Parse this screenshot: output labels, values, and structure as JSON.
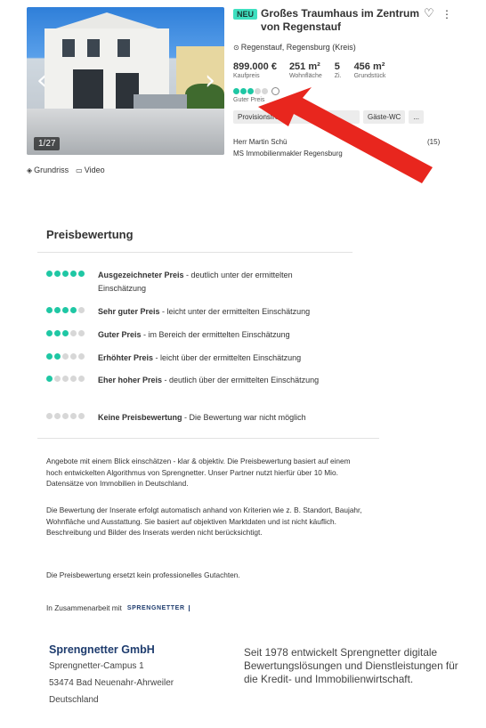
{
  "listing": {
    "photo_counter": "1/27",
    "badge": "NEU",
    "title": "Großes Traumhaus im Zentrum von Regenstauf",
    "location": "Regenstauf, Regensburg (Kreis)",
    "facts": [
      {
        "value": "899.000 €",
        "label": "Kaufpreis"
      },
      {
        "value": "251 m²",
        "label": "Wohnfläche"
      },
      {
        "value": "5",
        "label": "Zi."
      },
      {
        "value": "456 m²",
        "label": "Grundstück"
      }
    ],
    "rating": {
      "filled": 3,
      "total": 5,
      "label": "Guter Preis"
    },
    "tags": [
      "Provisionsfrei",
      "Gäste-WC",
      "..."
    ],
    "agent_name": "Herr Martin Schü",
    "agent_company": "MS Immobilienmakler Regensburg",
    "agent_count": "(15)",
    "media": {
      "floorplan": "Grundriss",
      "video": "Video"
    },
    "icons": {
      "favorite": "heart-icon",
      "more": "more-vertical-icon",
      "location": "pin-icon"
    }
  },
  "price_rating": {
    "title": "Preisbewertung",
    "levels": [
      {
        "filled": 5,
        "name": "Ausgezeichneter Preis",
        "desc": " - deutlich unter der ermittelten Einschätzung"
      },
      {
        "filled": 4,
        "name": "Sehr guter Preis",
        "desc": " - leicht unter der ermittelten Einschätzung"
      },
      {
        "filled": 3,
        "name": "Guter Preis",
        "desc": " - im Bereich der ermittelten Einschätzung"
      },
      {
        "filled": 2,
        "name": "Erhöhter Preis",
        "desc": " - leicht über der ermittelten Einschätzung"
      },
      {
        "filled": 1,
        "name": "Eher hoher Preis",
        "desc": " - deutlich über der ermittelten Einschätzung"
      },
      {
        "filled": 0,
        "name": "Keine Preisbewertung",
        "desc": " - Die Bewertung war nicht möglich"
      }
    ],
    "para1": "Angebote mit einem Blick einschätzen - klar & objektiv. Die Preisbewertung basiert auf einem hoch entwickelten Algorithmus von Sprengnetter. Unser Partner nutzt hierfür über 10 Mio. Datensätze von Immobilien in Deutschland.",
    "para2": "Die Bewertung der Inserate erfolgt automatisch anhand von Kriterien wie z. B. Standort, Baujahr, Wohnfläche und Ausstattung. Sie basiert auf objektiven Marktdaten und ist nicht käuflich. Beschreibung und Bilder des Inserats werden nicht berücksichtigt.",
    "para3": "Die Preisbewertung ersetzt kein professionelles Gutachten.",
    "cooperation": "In Zusammenarbeit mit",
    "logo_text": "SPRENGNETTER"
  },
  "company": {
    "name": "Sprengnetter GmbH",
    "street": "Sprengnetter-Campus 1",
    "city": "53474 Bad Neuenahr-Ahrweiler",
    "country": "Deutschland",
    "description": "Seit 1978 entwickelt Sprengnetter digitale Bewertungslösungen und Dienstleistungen für die Kredit- und Immobilienwirtschaft."
  },
  "colors": {
    "accent": "#1fc7a4",
    "dot_off": "#d7d7d7",
    "badge": "#3ee0c0",
    "brand": "#1e3c6e",
    "arrow": "#e8261e"
  }
}
